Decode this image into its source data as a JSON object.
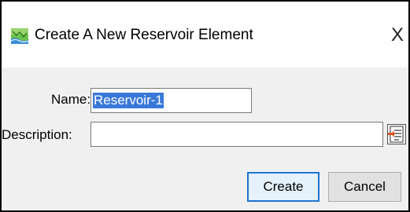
{
  "window": {
    "title": "Create A New Reservoir Element",
    "app_icon": "reservoir-element-icon",
    "close_glyph": "X"
  },
  "form": {
    "name_label": "Name:",
    "name_value": "Reservoir-1",
    "description_label": "Description:",
    "description_value": "",
    "editor_icon": "description-editor-icon"
  },
  "buttons": {
    "create_label": "Create",
    "cancel_label": "Cancel"
  },
  "colors": {
    "selection": "#3a78d8",
    "default_button_border": "#1e73d2",
    "dialog_background": "#f0f0f0"
  }
}
